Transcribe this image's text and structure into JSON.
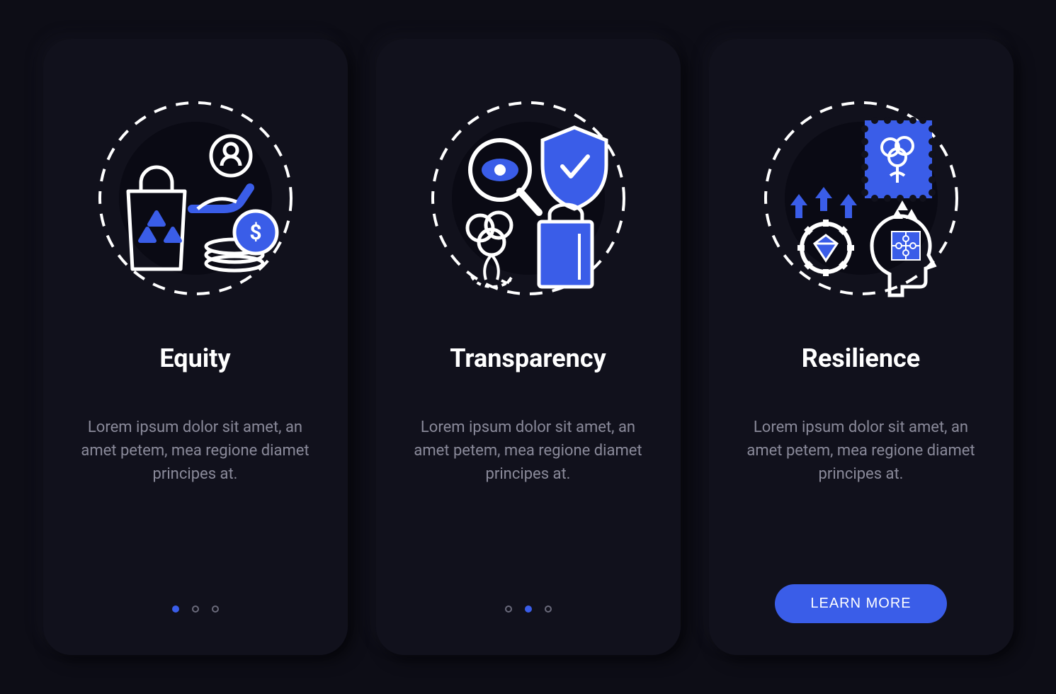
{
  "cards": [
    {
      "title": "Equity",
      "body": "Lorem ipsum dolor sit amet, an amet petem, mea regione diamet principes at.",
      "activeDot": 0,
      "showDots": true,
      "showCta": false
    },
    {
      "title": "Transparency",
      "body": "Lorem ipsum dolor sit amet, an amet petem, mea regione diamet principes at.",
      "activeDot": 1,
      "showDots": true,
      "showCta": false
    },
    {
      "title": "Resilience",
      "body": "Lorem ipsum dolor sit amet, an amet petem, mea regione diamet principes at.",
      "activeDot": 2,
      "showDots": false,
      "showCta": true
    }
  ],
  "ctaLabel": "LEARN MORE",
  "colors": {
    "accent": "#3a5de8",
    "bg": "#0d0d16",
    "cardBg": "#11111c",
    "text": "#ffffff",
    "muted": "#8a8a9a"
  }
}
